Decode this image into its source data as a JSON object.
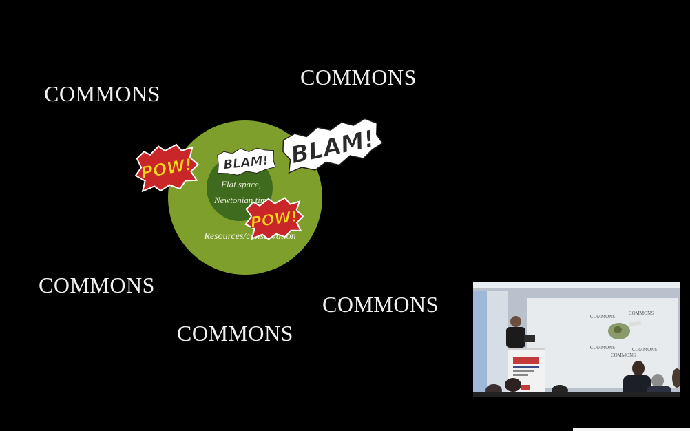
{
  "slide": {
    "commons": [
      "COMMONS",
      "COMMONS",
      "COMMONS",
      "COMMONS",
      "COMMONS"
    ],
    "diagram": {
      "inner_label_1": "Flat space,",
      "inner_label_2": "Newtonian time",
      "outer_label": "Resources/conservation",
      "pow_1": "POW!",
      "pow_2": "POW!",
      "blam_small": "BLAM!",
      "blam_large": "BLAM!"
    }
  },
  "speaker_inset": {
    "projected_words": [
      "COMMONS",
      "COMMONS",
      "COMMONS",
      "COMMONS",
      "COMMONS"
    ]
  },
  "colors": {
    "background": "#000000",
    "outer_circle": "#7e9f2c",
    "inner_circle": "#3f6b1e",
    "pow_yellow": "#f6d81c",
    "pow_red": "#c9262a"
  }
}
